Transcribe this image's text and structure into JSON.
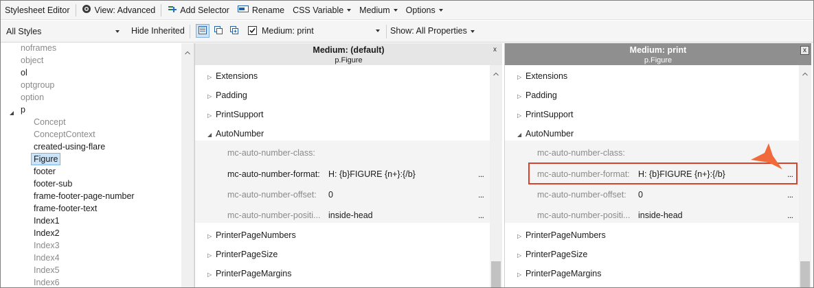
{
  "toolbar1": {
    "title": "Stylesheet Editor",
    "view": "View: Advanced",
    "add_selector": "Add Selector",
    "rename": "Rename",
    "css_variable": "CSS Variable",
    "medium": "Medium",
    "options": "Options"
  },
  "toolbar2": {
    "styles_select": "All Styles",
    "hide_inherited": "Hide Inherited",
    "medium_checkbox_checked": true,
    "medium_select": "Medium: print",
    "show_properties": "Show: All Properties"
  },
  "tree": {
    "items": [
      {
        "label": "noframes",
        "grey": true
      },
      {
        "label": "object",
        "grey": true
      },
      {
        "label": "ol",
        "grey": false
      },
      {
        "label": "optgroup",
        "grey": true
      },
      {
        "label": "option",
        "grey": true
      },
      {
        "label": "p",
        "grey": false
      },
      {
        "label": "Concept",
        "grey": true
      },
      {
        "label": "ConceptContext",
        "grey": true
      },
      {
        "label": "created-using-flare",
        "grey": false
      },
      {
        "label": "Figure",
        "grey": false,
        "selected": true
      },
      {
        "label": "footer",
        "grey": false
      },
      {
        "label": "footer-sub",
        "grey": false
      },
      {
        "label": "frame-footer-page-number",
        "grey": false
      },
      {
        "label": "frame-footer-text",
        "grey": false
      },
      {
        "label": "Index1",
        "grey": false
      },
      {
        "label": "Index2",
        "grey": false
      },
      {
        "label": "Index3",
        "grey": true
      },
      {
        "label": "Index4",
        "grey": true
      },
      {
        "label": "Index5",
        "grey": true
      },
      {
        "label": "Index6",
        "grey": true
      }
    ]
  },
  "panels": [
    {
      "title": "Medium: (default)",
      "subtitle": "p.Figure",
      "close": "x",
      "categories_top": [
        "Extensions",
        "Padding",
        "PrintSupport"
      ],
      "expanded_category": "AutoNumber",
      "properties": [
        {
          "name": "mc-auto-number-class:",
          "value": "",
          "dots": ""
        },
        {
          "name": "mc-auto-number-format:",
          "value": "H: {b}FIGURE {n+}:{/b}",
          "dots": "..."
        },
        {
          "name": "mc-auto-number-offset:",
          "value": "0",
          "dots": "..."
        },
        {
          "name": "mc-auto-number-positi...",
          "value": "inside-head",
          "dots": "..."
        }
      ],
      "categories_bottom": [
        "PrinterPageNumbers",
        "PrinterPageSize",
        "PrinterPageMargins"
      ]
    },
    {
      "title": "Medium: print",
      "subtitle": "p.Figure",
      "close": "x",
      "categories_top": [
        "Extensions",
        "Padding",
        "PrintSupport"
      ],
      "expanded_category": "AutoNumber",
      "properties": [
        {
          "name": "mc-auto-number-class:",
          "value": "",
          "dots": ""
        },
        {
          "name": "mc-auto-number-format:",
          "value": "H: {b}FIGURE {n+}:{/b}",
          "dots": "..."
        },
        {
          "name": "mc-auto-number-offset:",
          "value": "0",
          "dots": "..."
        },
        {
          "name": "mc-auto-number-positi...",
          "value": "inside-head",
          "dots": "..."
        }
      ],
      "categories_bottom": [
        "PrinterPageNumbers",
        "PrinterPageSize",
        "PrinterPageMargins"
      ]
    }
  ],
  "colors": {
    "highlight": "#d9412a",
    "callout": "#f06a3c",
    "header_default": "#e6e6e6",
    "header_active": "#8f8f8f"
  }
}
